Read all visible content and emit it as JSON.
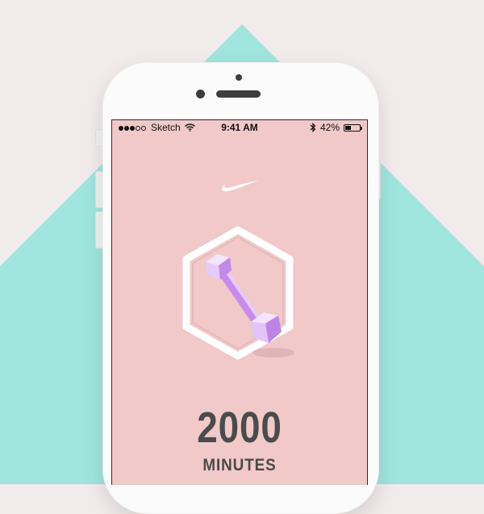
{
  "status_bar": {
    "carrier": "Sketch",
    "time": "9:41 AM",
    "battery_text": "42%",
    "battery_level": 0.42,
    "signal_bars_filled": 3,
    "signal_bars_total": 5
  },
  "brand": {
    "logo_icon": "swoosh-icon"
  },
  "achievement": {
    "icon": "dumbbell-icon",
    "frame": "hexagon-frame",
    "value": "2000",
    "unit": "MINUTES"
  },
  "colors": {
    "screen_bg": "#f0c9c8",
    "accent_mint": "#8de0d6",
    "dumbbell_purple": "#cf9ff0",
    "text_dark": "#4b4b4b"
  }
}
